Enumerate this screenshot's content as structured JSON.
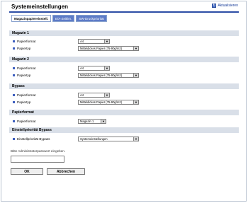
{
  "page": {
    "title": "Systemeinstellungen",
    "refresh_label": "Aktualisieren"
  },
  "tabs": [
    {
      "label": "Magazinpapiereinstell."
    },
    {
      "label": "E/A-Zeitlim."
    },
    {
      "label": "SW-Druckpriorität"
    }
  ],
  "sections": {
    "magazin1": {
      "title": "Magazin 1",
      "papierformat_label": "Papierformat",
      "papierformat_value": "A4",
      "papiertyp_label": "Papiertyp",
      "papiertyp_value": "Mitteldickes Papier (75-90g/m2)"
    },
    "magazin2": {
      "title": "Magazin 2",
      "papierformat_label": "Papierformat",
      "papierformat_value": "A4",
      "papiertyp_label": "Papiertyp",
      "papiertyp_value": "Mitteldickes Papier (75-90g/m2)"
    },
    "bypass": {
      "title": "Bypass",
      "papierformat_label": "Papierformat",
      "papierformat_value": "A4",
      "papiertyp_label": "Papiertyp",
      "papiertyp_value": "Mitteldickes Papier (75-90g/m2)"
    },
    "papierformat": {
      "title": "Papierformat",
      "label": "Papierformat",
      "value": "Magazin 1"
    },
    "einstellprioritaet": {
      "title": "Einstellpriorität Bypass",
      "label": "Einstellpriorität Bypass",
      "value": "Systemeinstellungen"
    }
  },
  "password": {
    "label": "Bitte Administratorpasswort eingeben.",
    "value": ""
  },
  "buttons": {
    "ok": "OK",
    "cancel": "Abbrechen"
  }
}
